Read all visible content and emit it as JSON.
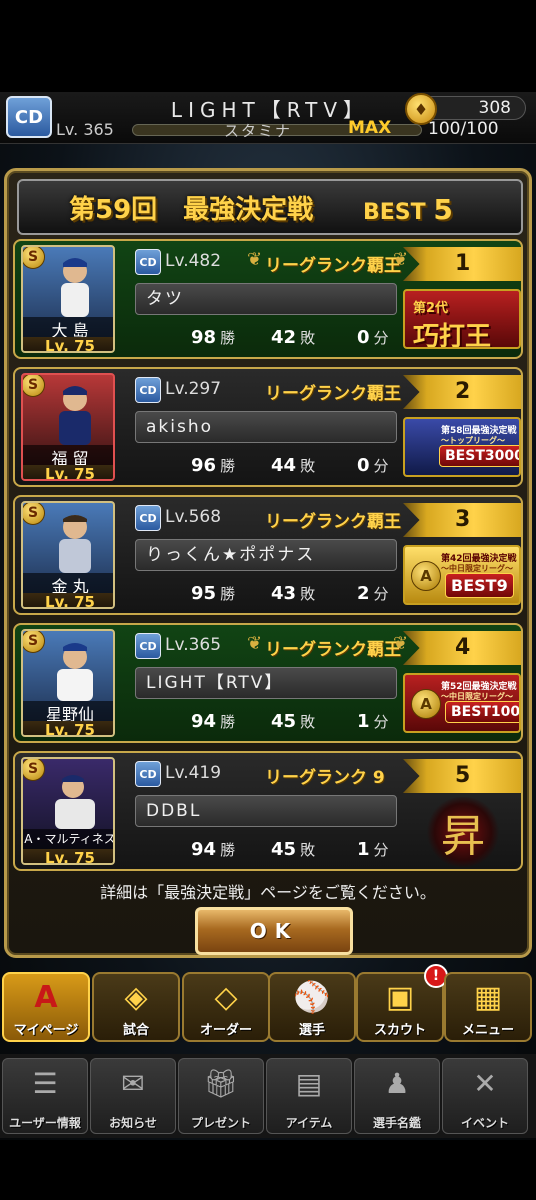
{
  "header": {
    "team_badge": "CD",
    "player_name": "LIGHT【RTV】",
    "coins": "308",
    "level": "Lv. 365",
    "stamina_label": "スタミナ",
    "stamina_max": "MAX",
    "stamina_value": "100/100"
  },
  "dialog": {
    "title": "第59回　最強決定戦",
    "best_prefix": "BEST",
    "best_num": "5",
    "detail": "詳細は「最強決定戦」ページをご覧ください。",
    "ok_label": "OK"
  },
  "rows": [
    {
      "card_name": "大 島",
      "card_lv": "Lv. 75",
      "lv": "Lv.482",
      "rank": "リーグランク覇王",
      "name": "タツ",
      "wins": "98",
      "losses": "42",
      "draws": "0",
      "position": "1",
      "award": {
        "title": "第2代",
        "big": "巧打王"
      }
    },
    {
      "card_name": "福 留",
      "card_lv": "Lv. 75",
      "lv": "Lv.297",
      "rank": "リーグランク覇王",
      "name": "akisho",
      "wins": "96",
      "losses": "44",
      "draws": "0",
      "position": "2",
      "award": {
        "title": "第58回最強決定戦",
        "sub": "〜トップリーグ〜",
        "big": "BEST3000"
      }
    },
    {
      "card_name": "金 丸",
      "card_lv": "Lv. 75",
      "lv": "Lv.568",
      "rank": "リーグランク覇王",
      "name": "りっくん★ポポナス",
      "wins": "95",
      "losses": "43",
      "draws": "2",
      "position": "3",
      "award": {
        "title": "第42回最強決定戦",
        "sub": "〜中日限定リーグ〜",
        "big": "BEST9"
      }
    },
    {
      "card_name": "星野仙",
      "card_lv": "Lv. 75",
      "lv": "Lv.365",
      "rank": "リーグランク覇王",
      "name": "LIGHT【RTV】",
      "wins": "94",
      "losses": "45",
      "draws": "1",
      "position": "4",
      "award": {
        "title": "第52回最強決定戦",
        "sub": "〜中日限定リーグ〜",
        "big": "BEST100"
      }
    },
    {
      "card_name": "A・マルティネス",
      "card_lv": "Lv. 75",
      "lv": "Lv.419",
      "rank": "リーグランク 9",
      "name": "DDBL",
      "wins": "94",
      "losses": "45",
      "draws": "1",
      "position": "5",
      "award": {
        "emblem": "昇"
      }
    }
  ],
  "units": {
    "win": "勝",
    "loss": "敗",
    "draw": "分"
  },
  "menu_main": [
    "マイページ",
    "試合",
    "オーダー",
    "選手",
    "スカウト",
    "メニュー"
  ],
  "menu_sub": [
    "ユーザー情報",
    "お知らせ",
    "プレゼント",
    "アイテム",
    "選手名鑑",
    "イベント"
  ],
  "notification": "!",
  "colors": {
    "gold": "#ffd24a",
    "row_green": "#114414",
    "panel_border": "#b89a4a"
  }
}
